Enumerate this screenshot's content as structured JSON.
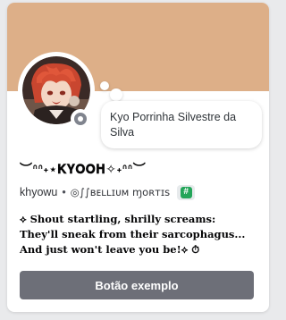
{
  "colors": {
    "banner": "#ddaf88",
    "button": "#6d6f78",
    "status": "#80848e",
    "hashtag_badge": "#23a559"
  },
  "profile": {
    "avatar": "avatar-image",
    "status": "offline",
    "custom_status": "Kyo Porrinha Silvestre da Silva",
    "display_name": "︶ᐢᐢ˖⋆𝐊𝐘𝐎𝐎𝐇✧˖ᐢᐢ︶",
    "username": "khyowu",
    "separator": "•",
    "pronouns": "◎∫∫ʙᴇʟʟɪᴜᴍ ɱᴏʀᴛɪs",
    "badge_icon": "hashtag-icon",
    "bio": [
      "⟡ Shout startling, shrilly screams:",
      "They'll sneak from their sarcophagus...",
      "And just won't leave you be!⟡ ⏱"
    ]
  },
  "actions": {
    "example_button": "Botão exemplo"
  }
}
